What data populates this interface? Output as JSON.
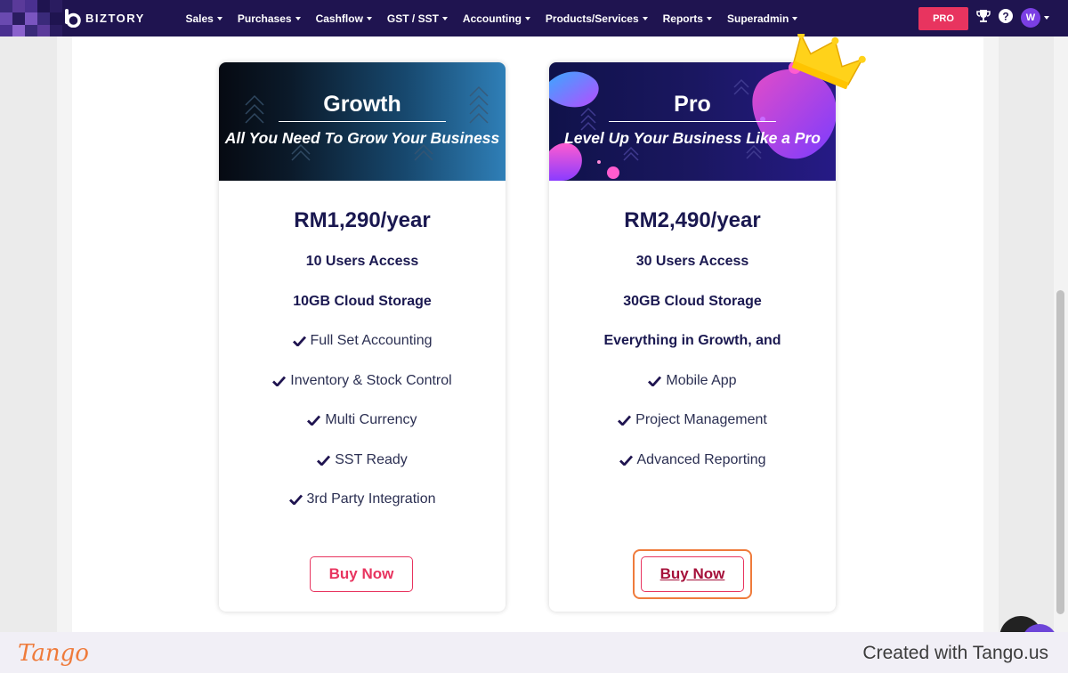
{
  "navbar": {
    "logo_text": "BIZTORY",
    "menu": [
      {
        "label": "Sales"
      },
      {
        "label": "Purchases"
      },
      {
        "label": "Cashflow"
      },
      {
        "label": "GST / SST"
      },
      {
        "label": "Accounting"
      },
      {
        "label": "Products/Services"
      },
      {
        "label": "Reports"
      },
      {
        "label": "Superadmin"
      }
    ],
    "pro_label": "PRO",
    "avatar_initial": "W",
    "icons": [
      "trophy-icon",
      "help-icon"
    ]
  },
  "plans": [
    {
      "name": "Growth",
      "tagline": "All You Need To Grow Your Business",
      "price": "RM1,290/year",
      "highlights": [
        "10 Users Access",
        "10GB Cloud Storage"
      ],
      "features": [
        "Full Set Accounting",
        "Inventory & Stock Control",
        "Multi Currency",
        "SST Ready",
        "3rd Party Integration"
      ],
      "button": "Buy Now"
    },
    {
      "name": "Pro",
      "tagline": "Level Up Your Business Like a Pro",
      "price": "RM2,490/year",
      "highlights": [
        "30 Users Access",
        "30GB Cloud Storage",
        "Everything in Growth, and"
      ],
      "features": [
        "Mobile App",
        "Project Management",
        "Advanced Reporting"
      ],
      "button": "Buy Now"
    }
  ],
  "footer": {
    "logo": "Tango",
    "text": "Created with Tango.us"
  },
  "colors": {
    "navbar": "#1f1450",
    "accent": "#e8345f",
    "text_dark": "#1a1850",
    "highlight_ring": "#ef7b3b"
  }
}
